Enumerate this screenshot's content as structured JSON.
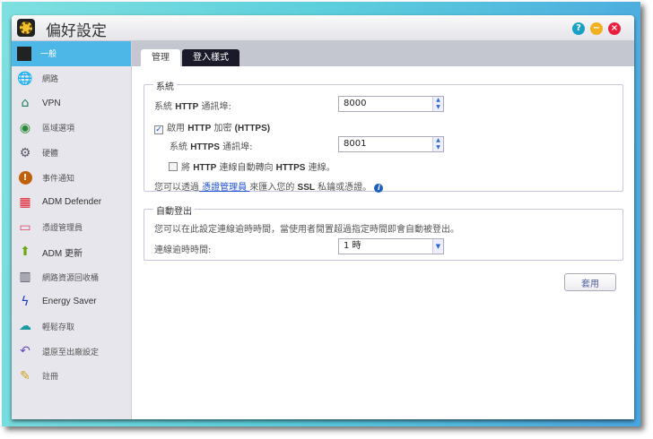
{
  "window": {
    "title": "偏好設定",
    "help_icon": "?",
    "minimize_icon": "−",
    "close_icon": "×"
  },
  "sidebar": {
    "items": [
      {
        "label": "一般",
        "icon": "server-icon",
        "active": true
      },
      {
        "label": "網路",
        "icon": "globe-icon"
      },
      {
        "label": "VPN",
        "icon": "house-icon"
      },
      {
        "label": "區域選項",
        "icon": "region-icon"
      },
      {
        "label": "硬體",
        "icon": "hardware-icon"
      },
      {
        "label": "事件通知",
        "icon": "alert-icon"
      },
      {
        "label": "ADM Defender",
        "icon": "firewall-icon"
      },
      {
        "label": "憑證管理員",
        "icon": "certificate-icon"
      },
      {
        "label": "ADM 更新",
        "icon": "update-arrow-icon"
      },
      {
        "label": "網路資源回收桶",
        "icon": "trash-icon"
      },
      {
        "label": "Energy Saver",
        "icon": "lightning-icon"
      },
      {
        "label": "輕鬆存取",
        "icon": "cloud-upload-icon"
      },
      {
        "label": "還原至出廠設定",
        "icon": "undo-icon"
      },
      {
        "label": "註冊",
        "icon": "register-icon"
      }
    ]
  },
  "tabs": [
    {
      "label": "管理",
      "active": true
    },
    {
      "label": "登入樣式",
      "active": false
    }
  ],
  "system": {
    "legend": "系統",
    "http_port_label_1": "系統 ",
    "http_port_label_b": "HTTP",
    "http_port_label_2": " 通訊埠:",
    "http_port_value": "8000",
    "https_enable_1": "啟用 ",
    "https_enable_b": "HTTP",
    "https_enable_2": " 加密 ",
    "https_enable_b2": "(HTTPS)",
    "https_enable_checked": true,
    "https_port_label_1": "系統 ",
    "https_port_label_b": "HTTPS",
    "https_port_label_2": " 通訊埠:",
    "https_port_value": "8001",
    "redirect_1": "將 ",
    "redirect_b": "HTTP",
    "redirect_2": " 連線自動轉向 ",
    "redirect_b2": "HTTPS",
    "redirect_3": " 連線。",
    "redirect_checked": false,
    "ssl_1": "您可以透過",
    "ssl_link": " 憑證管理員 ",
    "ssl_2": "來匯入您的 ",
    "ssl_b": "SSL",
    "ssl_3": " 私鑰或憑證。"
  },
  "autologout": {
    "legend": "自動登出",
    "desc": "您可以在此設定連線逾時時間，當使用者閒置超過指定時間即會自動被登出。",
    "timeout_label": "連線逾時時間:",
    "timeout_value": "1 時"
  },
  "apply_label": "套用"
}
